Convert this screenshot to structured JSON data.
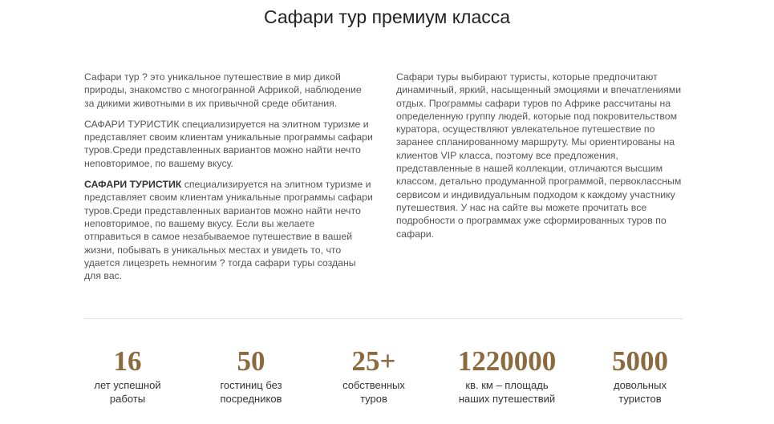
{
  "title": "Сафари тур премиум класса",
  "left_column": {
    "p1": "Сафари тур ? это уникальное путешествие в мир дикой природы, знакомство с многогранной Африкой, наблюдение за дикими животными в их привычной среде обитания.",
    "p2": "САФАРИ ТУРИСТИК специализируется на элитном туризме и представляет своим клиентам уникальные программы сафари туров.Среди представленных вариантов можно найти нечто неповторимое, по вашему вкусу.",
    "p3_bold": "САФАРИ ТУРИСТИК",
    "p3_rest": " специализируется на элитном туризме и представляет своим клиентам уникальные программы сафари туров.Среди представленных вариантов можно найти нечто неповторимое, по вашему вкусу. Если вы желаете отправиться в самое незабываемое путешествие в вашей жизни, побывать в уникальных местах и увидеть то, что удается лицезреть немногим ? тогда сафари туры созданы для вас."
  },
  "right_column": {
    "p1": "Сафари туры выбирают туристы, которые предпочитают динамичный, яркий, насыщенный эмоциями и впечатлениями отдых. Программы сафари туров по Африке рассчитаны на определенную группу людей, которые под покровительством куратора, осуществляют увлекательное путешествие по заранее спланированному маршруту. Мы ориентированы на клиентов VIP класса, поэтому все предложения, представленные в нашей коллекции, отличаются высшим классом, детально продуманной программой, первоклассным сервисом и индивидуальным подходом к каждому участнику путешествия. У нас на сайте вы можете прочитать все подробности о программах уже сформированных туров по сафари."
  },
  "accent_color": "#8b6a3e",
  "stats": [
    {
      "value": "16",
      "label": [
        "лет успешной",
        "работы"
      ]
    },
    {
      "value": "50",
      "label": [
        "гостиниц без",
        "посредников"
      ]
    },
    {
      "value": "25+",
      "label": [
        "собственных",
        "туров"
      ]
    },
    {
      "value": "1220000",
      "label": [
        "кв. км – площадь",
        "наших путешествий"
      ]
    },
    {
      "value": "5000",
      "label": [
        "довольных",
        "туристов"
      ]
    }
  ]
}
